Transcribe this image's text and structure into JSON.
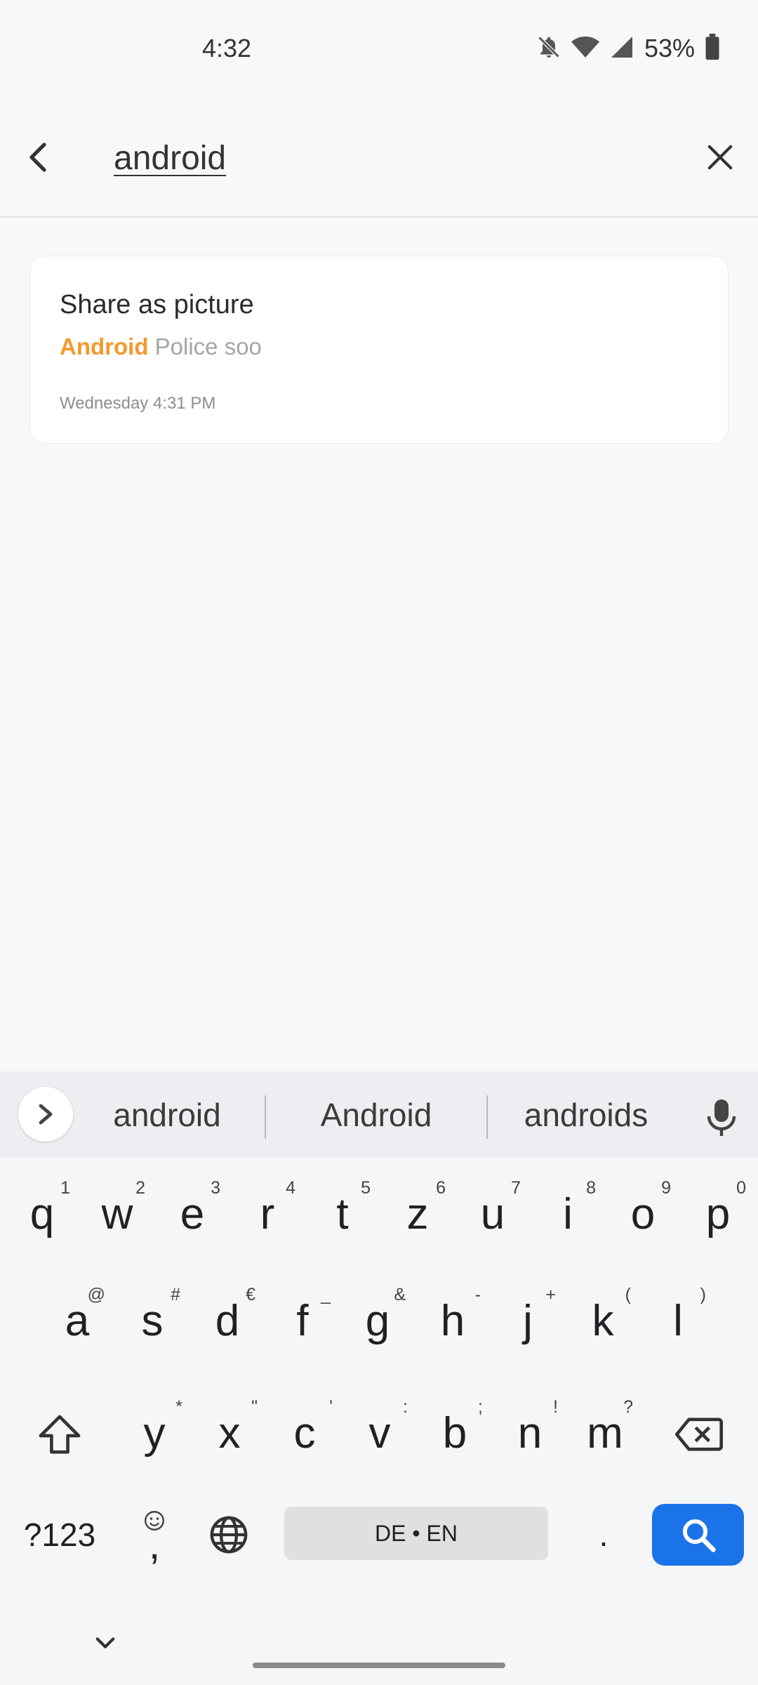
{
  "status_bar": {
    "time": "4:32",
    "battery_percent": "53%",
    "icons": [
      "bell-off-icon",
      "wifi-icon",
      "signal-icon",
      "battery-icon"
    ]
  },
  "search": {
    "back_icon": "chevron-left-icon",
    "query": "android",
    "clear_icon": "close-icon"
  },
  "results": [
    {
      "title": "Share as picture",
      "snippet_highlight": "Android",
      "snippet_rest": " Police soo",
      "date": "Wednesday 4:31 PM"
    }
  ],
  "keyboard": {
    "suggestions": [
      "android",
      "Android",
      "androids"
    ],
    "rows": [
      [
        {
          "k": "q",
          "h": "1"
        },
        {
          "k": "w",
          "h": "2"
        },
        {
          "k": "e",
          "h": "3"
        },
        {
          "k": "r",
          "h": "4"
        },
        {
          "k": "t",
          "h": "5"
        },
        {
          "k": "z",
          "h": "6"
        },
        {
          "k": "u",
          "h": "7"
        },
        {
          "k": "i",
          "h": "8"
        },
        {
          "k": "o",
          "h": "9"
        },
        {
          "k": "p",
          "h": "0"
        }
      ],
      [
        {
          "k": "a",
          "h": "@"
        },
        {
          "k": "s",
          "h": "#"
        },
        {
          "k": "d",
          "h": "€"
        },
        {
          "k": "f",
          "h": "_"
        },
        {
          "k": "g",
          "h": "&"
        },
        {
          "k": "h",
          "h": "-"
        },
        {
          "k": "j",
          "h": "+"
        },
        {
          "k": "k",
          "h": "("
        },
        {
          "k": "l",
          "h": ")"
        }
      ],
      [
        {
          "k": "y",
          "h": "*"
        },
        {
          "k": "x",
          "h": "\""
        },
        {
          "k": "c",
          "h": "'"
        },
        {
          "k": "v",
          "h": ":"
        },
        {
          "k": "b",
          "h": ";"
        },
        {
          "k": "n",
          "h": "!"
        },
        {
          "k": "m",
          "h": "?"
        }
      ]
    ],
    "symbols_label": "?123",
    "comma_label": ",",
    "space_label": "DE • EN",
    "period_label": ".",
    "colors": {
      "action": "#1a73e8",
      "highlight": "#f09a2c"
    }
  }
}
